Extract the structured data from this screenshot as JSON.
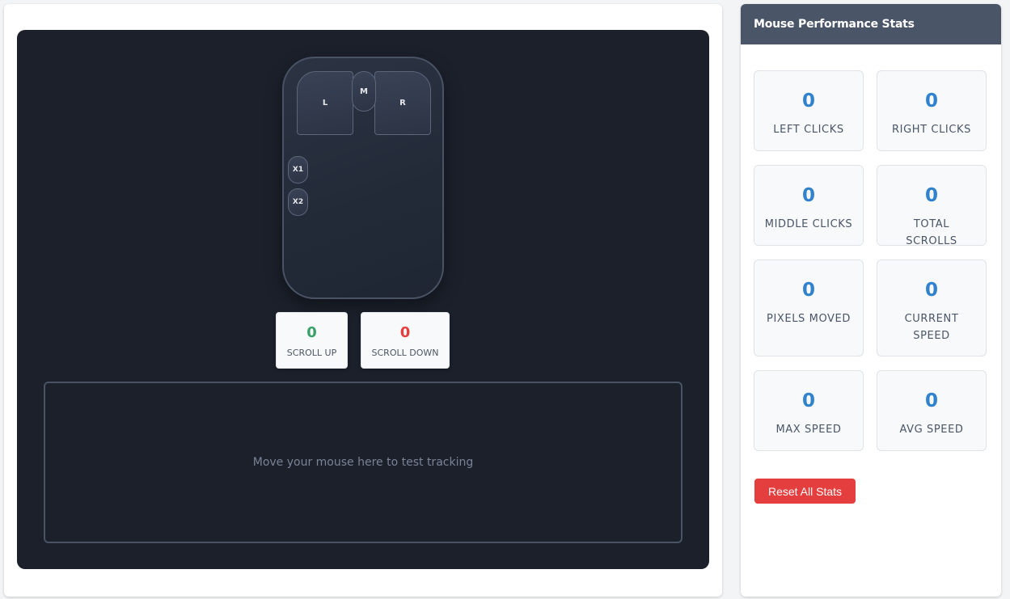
{
  "mouse": {
    "left_label": "L",
    "right_label": "R",
    "middle_label": "M",
    "x1_label": "X1",
    "x2_label": "X2"
  },
  "scroll": {
    "up_value": "0",
    "up_label": "SCROLL UP",
    "up_color": "#38a169",
    "down_value": "0",
    "down_label": "SCROLL DOWN",
    "down_color": "#e53e3e"
  },
  "tracking": {
    "text": "Move your mouse here to test tracking"
  },
  "sidebar": {
    "title": "Mouse Performance Stats",
    "stats": [
      {
        "value": "0",
        "label": "LEFT CLICKS"
      },
      {
        "value": "0",
        "label": "RIGHT CLICKS"
      },
      {
        "value": "0",
        "label": "MIDDLE CLICKS"
      },
      {
        "value": "0",
        "label": "TOTAL SCROLLS"
      },
      {
        "value": "0",
        "label": "PIXELS MOVED"
      },
      {
        "value": "0",
        "label": "CURRENT SPEED"
      },
      {
        "value": "0",
        "label": "MAX SPEED"
      },
      {
        "value": "0",
        "label": "AVG SPEED"
      }
    ],
    "reset_label": "Reset All Stats"
  },
  "colors": {
    "accent": "#3182ce",
    "danger": "#e53e3e",
    "header": "#4a5568",
    "panel": "#1b202b"
  }
}
